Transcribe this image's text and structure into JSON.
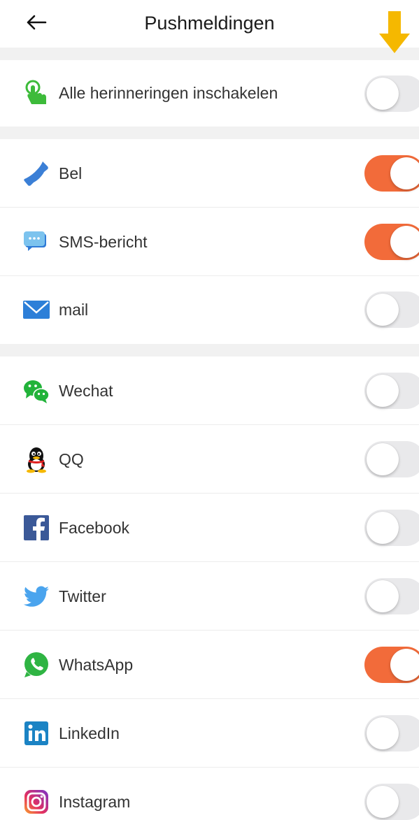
{
  "header": {
    "title": "Pushmeldingen",
    "back_icon": "arrow-left-icon",
    "indicator_icon": "arrow-down-icon",
    "indicator_color": "#F5B800"
  },
  "colors": {
    "toggle_on": "#F26B3A",
    "toggle_off": "#E9E9EB",
    "section_gap": "#F1F1F1"
  },
  "master": {
    "label": "Alle herinneringen inschakelen",
    "icon": "tap-finger-icon",
    "enabled": false
  },
  "basic": [
    {
      "label": "Bel",
      "icon": "phone-icon",
      "enabled": true
    },
    {
      "label": "SMS-bericht",
      "icon": "sms-message-icon",
      "enabled": true
    },
    {
      "label": "mail",
      "icon": "mail-icon",
      "enabled": false
    }
  ],
  "apps": [
    {
      "label": "Wechat",
      "icon": "wechat-icon",
      "enabled": false
    },
    {
      "label": "QQ",
      "icon": "qq-icon",
      "enabled": false
    },
    {
      "label": "Facebook",
      "icon": "facebook-icon",
      "enabled": false
    },
    {
      "label": "Twitter",
      "icon": "twitter-icon",
      "enabled": false
    },
    {
      "label": "WhatsApp",
      "icon": "whatsapp-icon",
      "enabled": true
    },
    {
      "label": "LinkedIn",
      "icon": "linkedin-icon",
      "enabled": false
    },
    {
      "label": "Instagram",
      "icon": "instagram-icon",
      "enabled": false
    }
  ]
}
